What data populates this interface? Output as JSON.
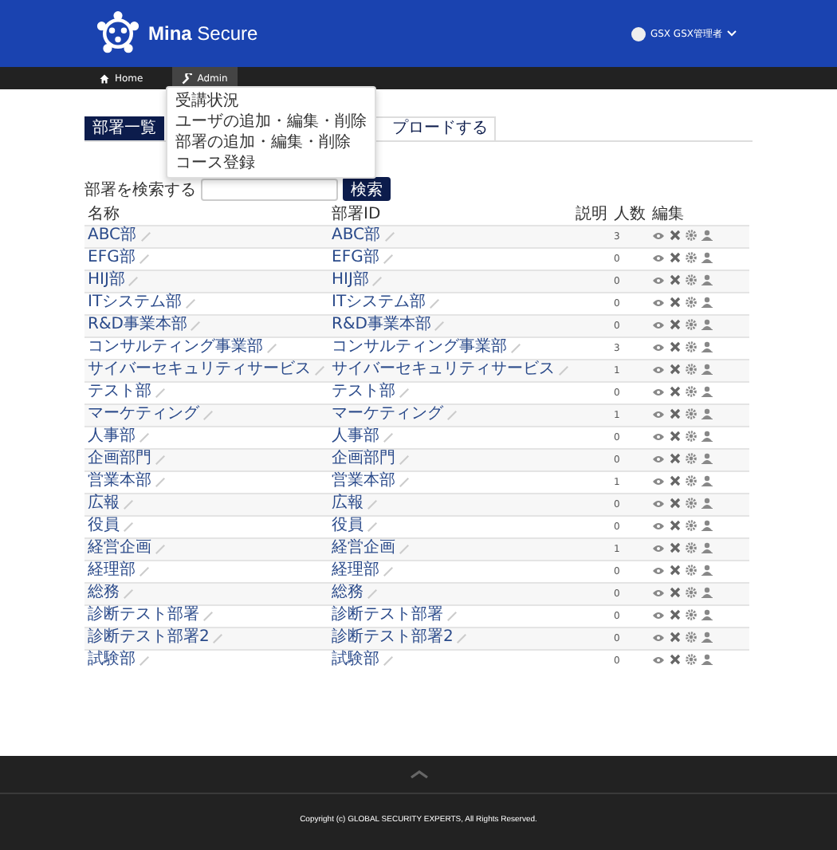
{
  "header": {
    "brand_bold": "Mina",
    "brand_light": "Secure",
    "user": "GSX GSX管理者"
  },
  "nav": [
    {
      "label": "Home",
      "selected": false
    },
    {
      "label": "Admin",
      "selected": true
    }
  ],
  "dropdown": [
    "受講状況",
    "ユーザの追加・編集・削除",
    "部署の追加・編集・削除",
    "コース登録"
  ],
  "tabs": [
    {
      "label": "部署一覧",
      "selected": true
    },
    {
      "label": "プロードする",
      "selected": false
    }
  ],
  "search": {
    "label": "部署を検索する",
    "button": "検索"
  },
  "table": {
    "columns": [
      "名称",
      "部署ID",
      "説明",
      "人数",
      "編集"
    ],
    "rows": [
      {
        "name": "ABC部",
        "id": "ABC部",
        "count": "3"
      },
      {
        "name": "EFG部",
        "id": "EFG部",
        "count": "0"
      },
      {
        "name": "HIJ部",
        "id": "HIJ部",
        "count": "0"
      },
      {
        "name": "ITシステム部",
        "id": "ITシステム部",
        "count": "0"
      },
      {
        "name": "R&D事業本部",
        "id": "R&D事業本部",
        "count": "0"
      },
      {
        "name": "コンサルティング事業部",
        "id": "コンサルティング事業部",
        "count": "3"
      },
      {
        "name": "サイバーセキュリティサービス",
        "id": "サイバーセキュリティサービス",
        "count": "1"
      },
      {
        "name": "テスト部",
        "id": "テスト部",
        "count": "0"
      },
      {
        "name": "マーケティング",
        "id": "マーケティング",
        "count": "1"
      },
      {
        "name": "人事部",
        "id": "人事部",
        "count": "0"
      },
      {
        "name": "企画部門",
        "id": "企画部門",
        "count": "0"
      },
      {
        "name": "営業本部",
        "id": "営業本部",
        "count": "1"
      },
      {
        "name": "広報",
        "id": "広報",
        "count": "0"
      },
      {
        "name": "役員",
        "id": "役員",
        "count": "0"
      },
      {
        "name": "経営企画",
        "id": "経営企画",
        "count": "1"
      },
      {
        "name": "経理部",
        "id": "経理部",
        "count": "0"
      },
      {
        "name": "総務",
        "id": "総務",
        "count": "0"
      },
      {
        "name": "診断テスト部署",
        "id": "診断テスト部署",
        "count": "0"
      },
      {
        "name": "診断テスト部署2",
        "id": "診断テスト部署2",
        "count": "0"
      },
      {
        "name": "試験部",
        "id": "試験部",
        "count": "0"
      }
    ]
  },
  "footer": {
    "copyright": "Copyright (c) GLOBAL SECURITY EXPERTS, All Rights Reserved."
  }
}
